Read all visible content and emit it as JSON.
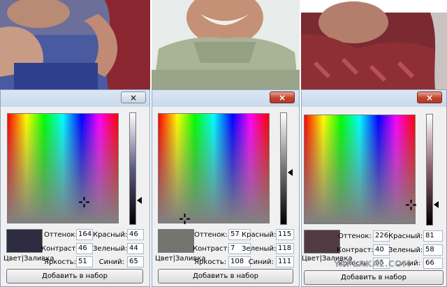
{
  "panels": [
    {
      "close": "×",
      "hue_label": "Оттенок:",
      "hue": "164",
      "sat_label": "Контраст:",
      "sat": "46",
      "lum_label": "Яркость:",
      "lum": "51",
      "red_label": "Красный:",
      "red": "46",
      "green_label": "Зеленый:",
      "green": "44",
      "blue_label": "Синий:",
      "blue": "65",
      "color_label": "Цвет|Заливка",
      "add_label": "Добавить в набор",
      "swatch_color": "#2e2c41"
    },
    {
      "close": "×",
      "hue_label": "Оттенок:",
      "hue": "57",
      "sat_label": "Контраст:",
      "sat": "7",
      "lum_label": "Яркость:",
      "lum": "108",
      "red_label": "Красный:",
      "red": "115",
      "green_label": "Зеленый:",
      "green": "118",
      "blue_label": "Синий:",
      "blue": "111",
      "color_label": "Цвет|Заливка",
      "add_label": "Добавить в набор",
      "swatch_color": "#73766f"
    },
    {
      "close": "×",
      "hue_label": "Оттенок:",
      "hue": "226",
      "sat_label": "Контраст:",
      "sat": "40",
      "lum_label": "Яркость:",
      "lum": "65",
      "red_label": "Красный:",
      "red": "81",
      "green_label": "Зеленый:",
      "green": "58",
      "blue_label": "Синий:",
      "blue": "66",
      "color_label": "Цвет|Заливка",
      "add_label": "Добавить в набор",
      "swatch_color": "#513a42"
    }
  ],
  "watermark": "YAPLAKAL.COM"
}
